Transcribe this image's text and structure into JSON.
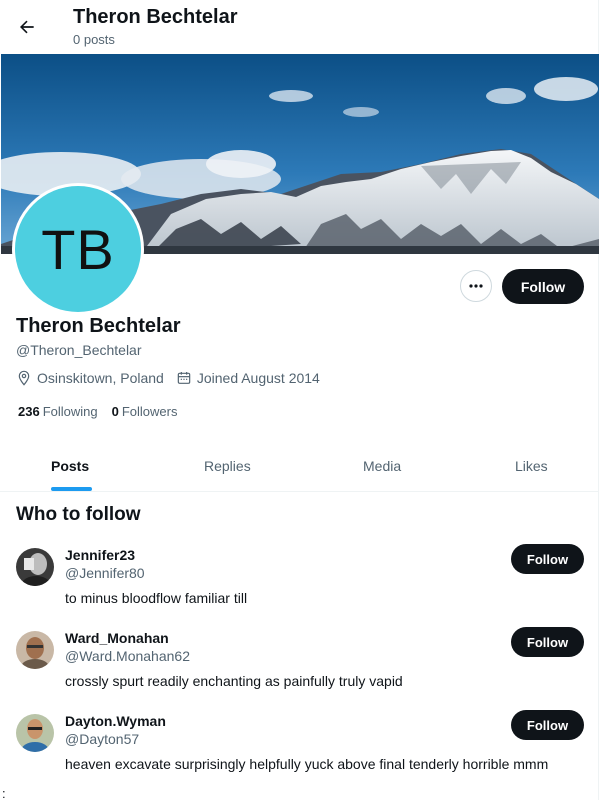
{
  "header": {
    "name": "Theron Bechtelar",
    "post_count": "0 posts"
  },
  "profile": {
    "initials": "TB",
    "display_name": "Theron Bechtelar",
    "handle": "@Theron_Bechtelar",
    "location": "Osinskitown, Poland",
    "joined": "Joined August 2014",
    "following_count": "236",
    "following_label": "Following",
    "followers_count": "0",
    "followers_label": "Followers",
    "follow_label": "Follow",
    "avatar_color": "#4dcfe0"
  },
  "tabs": [
    {
      "label": "Posts",
      "active": true
    },
    {
      "label": "Replies",
      "active": false
    },
    {
      "label": "Media",
      "active": false
    },
    {
      "label": "Likes",
      "active": false
    }
  ],
  "who_to_follow": {
    "title": "Who to follow",
    "items": [
      {
        "name": "Jennifer23",
        "handle": "@Jennifer80",
        "bio": "to minus bloodflow familiar till",
        "follow_label": "Follow"
      },
      {
        "name": "Ward_Monahan",
        "handle": "@Ward.Monahan62",
        "bio": "crossly spurt readily enchanting as painfully truly vapid",
        "follow_label": "Follow"
      },
      {
        "name": "Dayton.Wyman",
        "handle": "@Dayton57",
        "bio": "heaven excavate surprisingly helpfully yuck above final tenderly horrible mmm",
        "follow_label": "Follow"
      }
    ]
  },
  "stray_text": ":",
  "colors": {
    "accent": "#1d9bf0",
    "button_dark": "#0f1419",
    "muted_text": "#536471"
  }
}
